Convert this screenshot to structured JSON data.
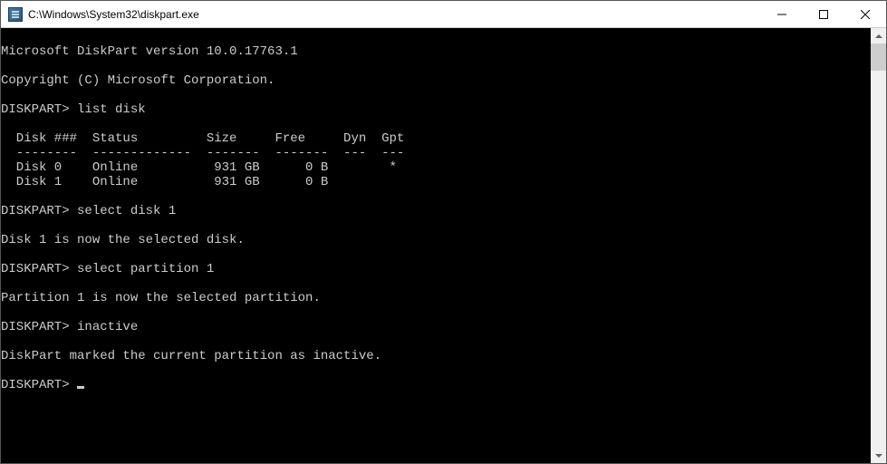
{
  "window": {
    "title": "C:\\Windows\\System32\\diskpart.exe"
  },
  "console": {
    "blank0": "",
    "version_line": "Microsoft DiskPart version 10.0.17763.1",
    "blank1": "",
    "copyright_line": "Copyright (C) Microsoft Corporation.",
    "blank2": "",
    "prompt1": "DISKPART> list disk",
    "blank3": "",
    "table_header": "  Disk ###  Status         Size     Free     Dyn  Gpt",
    "table_divider": "  --------  -------------  -------  -------  ---  ---",
    "disk0_row": "  Disk 0    Online          931 GB      0 B        *",
    "disk1_row": "  Disk 1    Online          931 GB      0 B",
    "blank4": "",
    "prompt2": "DISKPART> select disk 1",
    "blank5": "",
    "msg_disk_selected": "Disk 1 is now the selected disk.",
    "blank6": "",
    "prompt3": "DISKPART> select partition 1",
    "blank7": "",
    "msg_partition_selected": "Partition 1 is now the selected partition.",
    "blank8": "",
    "prompt4": "DISKPART> inactive",
    "blank9": "",
    "msg_inactive": "DiskPart marked the current partition as inactive.",
    "blank10": "",
    "prompt5": "DISKPART> "
  }
}
